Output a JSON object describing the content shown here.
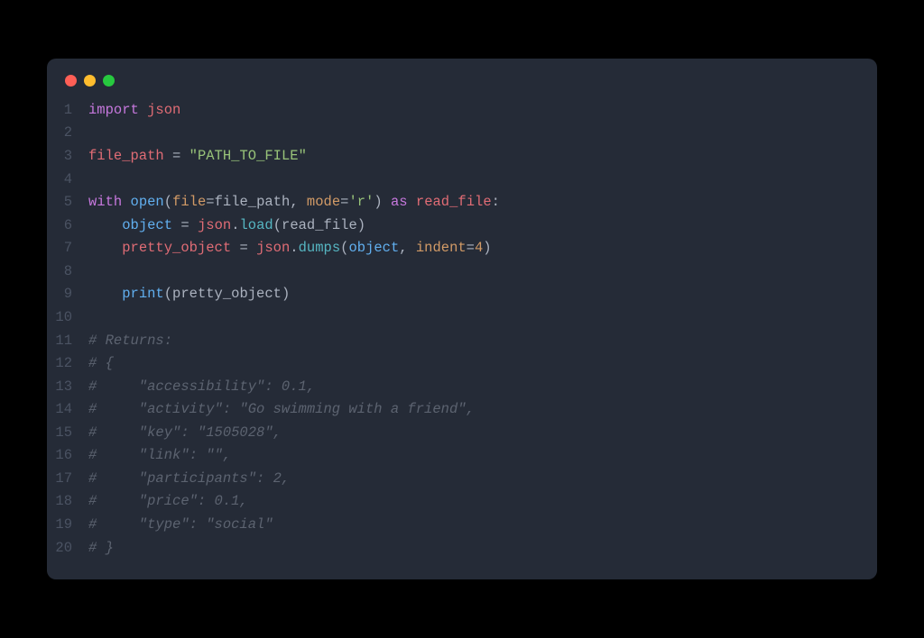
{
  "window": {
    "traffic_lights": [
      "close",
      "minimize",
      "zoom"
    ]
  },
  "code": {
    "language": "python",
    "lines": [
      {
        "n": 1,
        "tokens": [
          [
            "kw",
            "import"
          ],
          [
            "plain",
            " "
          ],
          [
            "id",
            "json"
          ]
        ]
      },
      {
        "n": 2,
        "tokens": []
      },
      {
        "n": 3,
        "tokens": [
          [
            "id",
            "file_path"
          ],
          [
            "plain",
            " "
          ],
          [
            "op",
            "="
          ],
          [
            "plain",
            " "
          ],
          [
            "str",
            "\"PATH_TO_FILE\""
          ]
        ]
      },
      {
        "n": 4,
        "tokens": []
      },
      {
        "n": 5,
        "tokens": [
          [
            "kw",
            "with"
          ],
          [
            "plain",
            " "
          ],
          [
            "fn",
            "open"
          ],
          [
            "op",
            "("
          ],
          [
            "param",
            "file"
          ],
          [
            "op",
            "="
          ],
          [
            "plain",
            "file_path"
          ],
          [
            "op",
            ", "
          ],
          [
            "param",
            "mode"
          ],
          [
            "op",
            "="
          ],
          [
            "str",
            "'r'"
          ],
          [
            "op",
            ")"
          ],
          [
            "plain",
            " "
          ],
          [
            "kw",
            "as"
          ],
          [
            "plain",
            " "
          ],
          [
            "id",
            "read_file"
          ],
          [
            "op",
            ":"
          ]
        ]
      },
      {
        "n": 6,
        "tokens": [
          [
            "plain",
            "    "
          ],
          [
            "fn",
            "object"
          ],
          [
            "plain",
            " "
          ],
          [
            "op",
            "="
          ],
          [
            "plain",
            " "
          ],
          [
            "id",
            "json"
          ],
          [
            "op",
            "."
          ],
          [
            "call",
            "load"
          ],
          [
            "op",
            "("
          ],
          [
            "plain",
            "read_file"
          ],
          [
            "op",
            ")"
          ]
        ]
      },
      {
        "n": 7,
        "tokens": [
          [
            "plain",
            "    "
          ],
          [
            "id",
            "pretty_object"
          ],
          [
            "plain",
            " "
          ],
          [
            "op",
            "="
          ],
          [
            "plain",
            " "
          ],
          [
            "id",
            "json"
          ],
          [
            "op",
            "."
          ],
          [
            "call",
            "dumps"
          ],
          [
            "op",
            "("
          ],
          [
            "fn",
            "object"
          ],
          [
            "op",
            ", "
          ],
          [
            "param",
            "indent"
          ],
          [
            "op",
            "="
          ],
          [
            "num",
            "4"
          ],
          [
            "op",
            ")"
          ]
        ]
      },
      {
        "n": 8,
        "tokens": []
      },
      {
        "n": 9,
        "tokens": [
          [
            "plain",
            "    "
          ],
          [
            "fn",
            "print"
          ],
          [
            "op",
            "("
          ],
          [
            "plain",
            "pretty_object"
          ],
          [
            "op",
            ")"
          ]
        ]
      },
      {
        "n": 10,
        "tokens": []
      },
      {
        "n": 11,
        "tokens": [
          [
            "cmnt",
            "# Returns:"
          ]
        ]
      },
      {
        "n": 12,
        "tokens": [
          [
            "cmnt",
            "# {"
          ]
        ]
      },
      {
        "n": 13,
        "tokens": [
          [
            "cmnt",
            "#     \"accessibility\": 0.1,"
          ]
        ]
      },
      {
        "n": 14,
        "tokens": [
          [
            "cmnt",
            "#     \"activity\": \"Go swimming with a friend\","
          ]
        ]
      },
      {
        "n": 15,
        "tokens": [
          [
            "cmnt",
            "#     \"key\": \"1505028\","
          ]
        ]
      },
      {
        "n": 16,
        "tokens": [
          [
            "cmnt",
            "#     \"link\": \"\","
          ]
        ]
      },
      {
        "n": 17,
        "tokens": [
          [
            "cmnt",
            "#     \"participants\": 2,"
          ]
        ]
      },
      {
        "n": 18,
        "tokens": [
          [
            "cmnt",
            "#     \"price\": 0.1,"
          ]
        ]
      },
      {
        "n": 19,
        "tokens": [
          [
            "cmnt",
            "#     \"type\": \"social\""
          ]
        ]
      },
      {
        "n": 20,
        "tokens": [
          [
            "cmnt",
            "# }"
          ]
        ]
      }
    ]
  }
}
